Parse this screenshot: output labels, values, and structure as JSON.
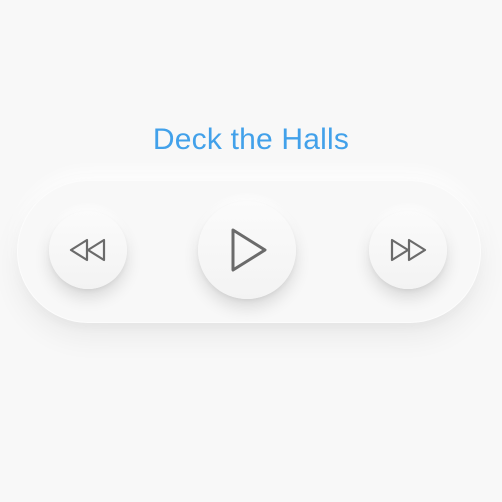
{
  "player": {
    "track_title": "Deck the Halls",
    "accent_color": "#42a1ea",
    "icon_color": "#6b6b6b"
  },
  "controls": {
    "rewind": {
      "icon": "rewind-icon"
    },
    "play": {
      "icon": "play-icon"
    },
    "forward": {
      "icon": "fast-forward-icon"
    }
  }
}
